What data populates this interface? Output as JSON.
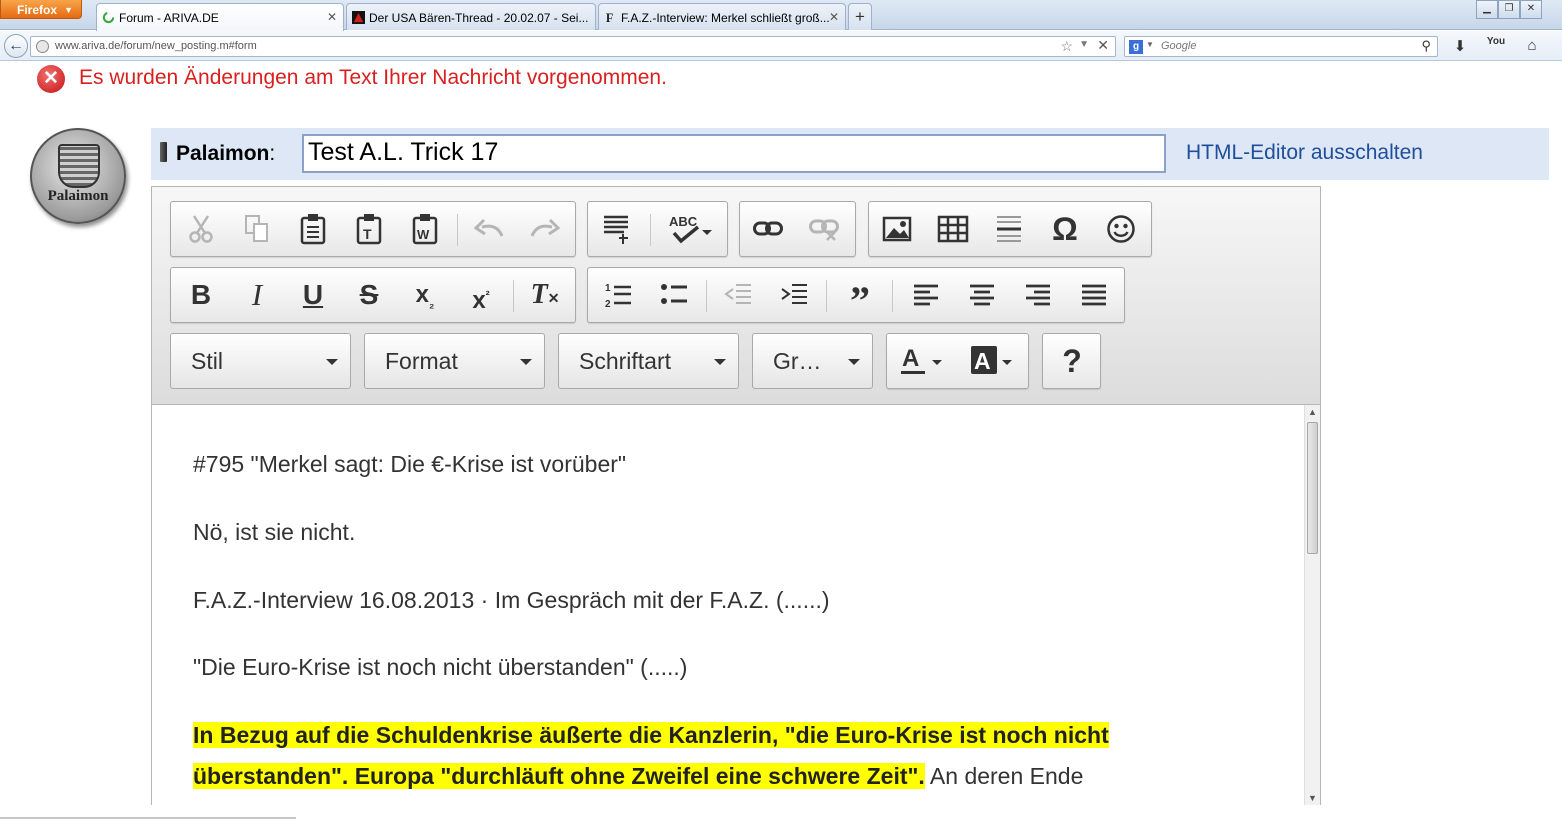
{
  "browser": {
    "menu_button": "Firefox",
    "tabs": [
      {
        "title": "Forum - ARIVA.DE",
        "active": true
      },
      {
        "title": "Der USA Bären-Thread - 20.02.07 - Sei...",
        "active": false
      },
      {
        "title": "F.A.Z.-Interview: Merkel schließt groß...",
        "active": false
      }
    ],
    "new_tab": "+",
    "url": "www.ariva.de/forum/new_posting.m#form",
    "search_placeholder": "Google",
    "search_engine_glyph": "g",
    "youtube_label": "You"
  },
  "page": {
    "error_message": "Es wurden Änderungen am Text Ihrer Nachricht vorgenommen.",
    "avatar_text": "Palaimon",
    "username": "Palaimon",
    "username_suffix": ":",
    "subject_value": "Test A.L. Trick 17",
    "html_editor_toggle": "HTML-Editor ausschalten"
  },
  "editor": {
    "combos": {
      "style": "Stil",
      "format": "Format",
      "font": "Schriftart",
      "size": "Gr…"
    },
    "help_label": "?",
    "paragraphs": [
      "#795 \"Merkel sagt: Die €-Krise ist vorüber\"",
      "Nö, ist sie nicht.",
      "F.A.Z.-Interview 16.08.2013 · Im Gespräch mit der F.A.Z. (......)",
      "\"Die Euro-Krise ist noch nicht überstanden\" (.....)"
    ],
    "highlight_line1": "In Bezug auf die Schuldenkrise äußerte die Kanzlerin, \"die Euro-Krise ist noch nicht",
    "highlight_line2": "überstanden\". Europa \"durchläuft ohne Zweifel eine schwere Zeit\".",
    "plain_tail": " An deren Ende"
  },
  "colors": {
    "error_red": "#d91f1f",
    "link_blue": "#1f4e9b",
    "highlight": "#ffff00",
    "subject_row_bg": "#dde7f5"
  }
}
